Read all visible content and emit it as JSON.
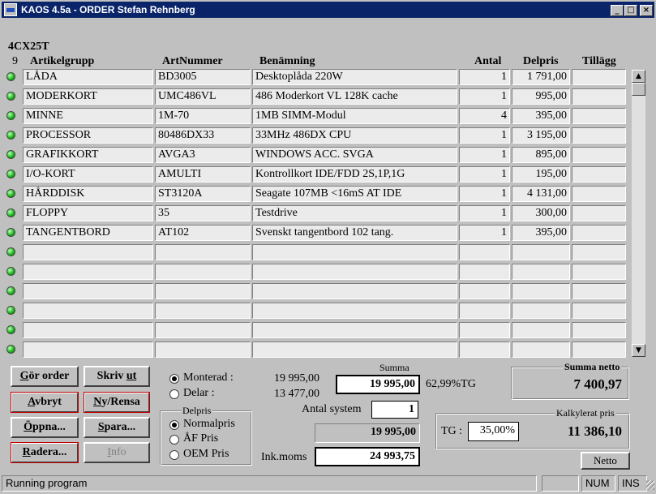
{
  "window": {
    "title": "KAOS 4.5a - ORDER  Stefan Rehnberg",
    "minimize": "_",
    "maximize": "□",
    "close": "×"
  },
  "config_code": "4CX25T",
  "columns": {
    "count": "9",
    "artikelgrupp": "Artikelgrupp",
    "artnummer": "ArtNummer",
    "benamning": "Benämning",
    "antal": "Antal",
    "delpris": "Delpris",
    "tillagg": "Tillägg"
  },
  "rows": [
    {
      "grupp": "LÅDA",
      "art": "BD3005",
      "ben": "Desktoplåda 220W",
      "antal": "1",
      "delpris": "1 791,00",
      "tillagg": ""
    },
    {
      "grupp": "MODERKORT",
      "art": "UMC486VL",
      "ben": "486 Moderkort VL 128K cache",
      "antal": "1",
      "delpris": "995,00",
      "tillagg": ""
    },
    {
      "grupp": "MINNE",
      "art": "1M-70",
      "ben": "1MB SIMM-Modul",
      "antal": "4",
      "delpris": "395,00",
      "tillagg": ""
    },
    {
      "grupp": "PROCESSOR",
      "art": "80486DX33",
      "ben": "33MHz 486DX CPU",
      "antal": "1",
      "delpris": "3 195,00",
      "tillagg": ""
    },
    {
      "grupp": "GRAFIKKORT",
      "art": "AVGA3",
      "ben": "WINDOWS ACC. SVGA",
      "antal": "1",
      "delpris": "895,00",
      "tillagg": ""
    },
    {
      "grupp": "I/O-KORT",
      "art": "AMULTI",
      "ben": "Kontrollkort IDE/FDD 2S,1P,1G",
      "antal": "1",
      "delpris": "195,00",
      "tillagg": ""
    },
    {
      "grupp": "HÅRDDISK",
      "art": "ST3120A",
      "ben": "Seagate 107MB <16mS AT IDE",
      "antal": "1",
      "delpris": "4 131,00",
      "tillagg": ""
    },
    {
      "grupp": "FLOPPY",
      "art": "35",
      "ben": "Testdrive",
      "antal": "1",
      "delpris": "300,00",
      "tillagg": ""
    },
    {
      "grupp": "TANGENTBORD",
      "art": "AT102",
      "ben": "Svenskt tangentbord 102 tang.",
      "antal": "1",
      "delpris": "395,00",
      "tillagg": ""
    },
    {
      "grupp": "",
      "art": "",
      "ben": "",
      "antal": "",
      "delpris": "",
      "tillagg": ""
    },
    {
      "grupp": "",
      "art": "",
      "ben": "",
      "antal": "",
      "delpris": "",
      "tillagg": ""
    },
    {
      "grupp": "",
      "art": "",
      "ben": "",
      "antal": "",
      "delpris": "",
      "tillagg": ""
    },
    {
      "grupp": "",
      "art": "",
      "ben": "",
      "antal": "",
      "delpris": "",
      "tillagg": ""
    },
    {
      "grupp": "",
      "art": "",
      "ben": "",
      "antal": "",
      "delpris": "",
      "tillagg": ""
    },
    {
      "grupp": "",
      "art": "",
      "ben": "",
      "antal": "",
      "delpris": "",
      "tillagg": ""
    }
  ],
  "buttons": {
    "gor_order": "Gör order",
    "skriv_ut": "Skriv ut",
    "avbryt": "Avbryt",
    "ny_rensa": "Ny/Rensa",
    "oppna": "Öppna...",
    "spara": "Spara...",
    "radera": "Radera...",
    "info": "Info",
    "netto": "Netto"
  },
  "assembly": {
    "monterad_label": "Monterad :",
    "delar_label": "Delar :",
    "monterad_value": "19 995,00",
    "delar_value": "13 477,00",
    "selected": "monterad"
  },
  "delpris_group": {
    "title": "Delpris",
    "options": [
      "Normalpris",
      "ÅF Pris",
      "OEM Pris"
    ],
    "selected": "Normalpris"
  },
  "summa": {
    "label": "Summa",
    "value": "19 995,00",
    "tg_percent": "62,99%TG"
  },
  "antal_system": {
    "label": "Antal system",
    "value": "1"
  },
  "total": {
    "value": "19 995,00"
  },
  "inkmoms": {
    "label": "Ink.moms",
    "value": "24 993,75"
  },
  "summa_netto": {
    "title": "Summa netto",
    "value": "7 400,97"
  },
  "kalkylerat": {
    "title": "Kalkylerat pris",
    "tg_label": "TG :",
    "tg_value": "35,00%",
    "value": "11 386,10"
  },
  "statusbar": {
    "message": "Running program",
    "num": "NUM",
    "ins": "INS"
  },
  "scrollbar": {
    "up": "▲",
    "down": "▼"
  }
}
